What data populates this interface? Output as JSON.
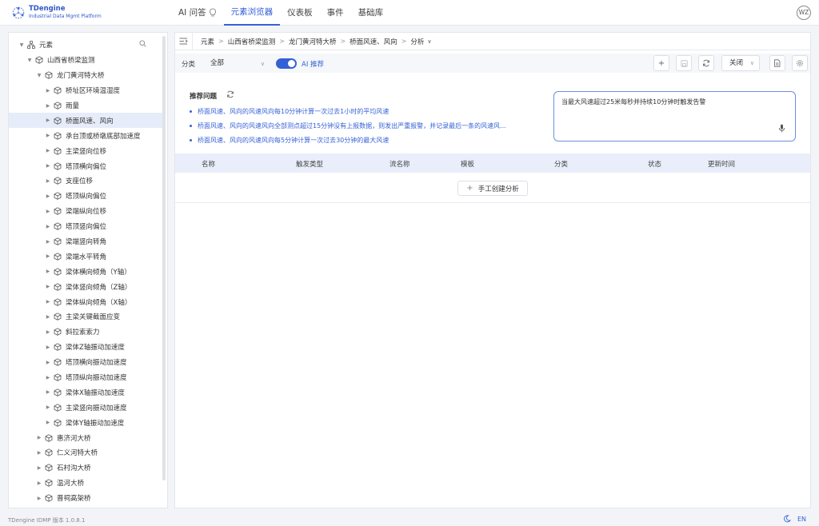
{
  "app": {
    "logo_title": "TDengine",
    "logo_subtitle": "Industrial Data Mgmt Platform",
    "brand_color": "#3561d6"
  },
  "nav": {
    "items": [
      {
        "label": "AI 问答"
      },
      {
        "label": "元素浏览器",
        "active": true
      },
      {
        "label": "仪表板"
      },
      {
        "label": "事件"
      },
      {
        "label": "基础库"
      }
    ],
    "user_initials": "WZ"
  },
  "sidebar": {
    "tree": [
      {
        "label": "元素",
        "level": 0,
        "icon": "hierarchy-icon",
        "expanded": true
      },
      {
        "label": "山西省桥梁监测",
        "level": 1,
        "icon": "cube-icon",
        "expanded": true
      },
      {
        "label": "龙门黄河特大桥",
        "level": 2,
        "icon": "cube-icon",
        "expanded": true
      },
      {
        "label": "桥址区环境温湿度",
        "level": 3,
        "icon": "cube-icon"
      },
      {
        "label": "雨量",
        "level": 3,
        "icon": "cube-icon"
      },
      {
        "label": "桥面风速、风向",
        "level": 3,
        "icon": "cube-icon",
        "selected": true
      },
      {
        "label": "承台顶或桥墩底部加速度",
        "level": 3,
        "icon": "cube-icon"
      },
      {
        "label": "主梁竖向位移",
        "level": 3,
        "icon": "cube-icon"
      },
      {
        "label": "塔顶横向偏位",
        "level": 3,
        "icon": "cube-icon"
      },
      {
        "label": "支座位移",
        "level": 3,
        "icon": "cube-icon"
      },
      {
        "label": "塔顶纵向偏位",
        "level": 3,
        "icon": "cube-icon"
      },
      {
        "label": "梁端纵向位移",
        "level": 3,
        "icon": "cube-icon"
      },
      {
        "label": "塔顶竖向偏位",
        "level": 3,
        "icon": "cube-icon"
      },
      {
        "label": "梁端竖向转角",
        "level": 3,
        "icon": "cube-icon"
      },
      {
        "label": "梁端水平转角",
        "level": 3,
        "icon": "cube-icon"
      },
      {
        "label": "梁体横向倾角（Y轴）",
        "level": 3,
        "icon": "cube-icon"
      },
      {
        "label": "梁体竖向倾角（Z轴）",
        "level": 3,
        "icon": "cube-icon"
      },
      {
        "label": "梁体纵向倾角（X轴）",
        "level": 3,
        "icon": "cube-icon"
      },
      {
        "label": "主梁关键截面应变",
        "level": 3,
        "icon": "cube-icon"
      },
      {
        "label": "斜拉索索力",
        "level": 3,
        "icon": "cube-icon"
      },
      {
        "label": "梁体Z轴振动加速度",
        "level": 3,
        "icon": "cube-icon"
      },
      {
        "label": "塔顶横向振动加速度",
        "level": 3,
        "icon": "cube-icon"
      },
      {
        "label": "塔顶纵向振动加速度",
        "level": 3,
        "icon": "cube-icon"
      },
      {
        "label": "梁体X轴振动加速度",
        "level": 3,
        "icon": "cube-icon"
      },
      {
        "label": "主梁竖向振动加速度",
        "level": 3,
        "icon": "cube-icon"
      },
      {
        "label": "梁体Y轴振动加速度",
        "level": 3,
        "icon": "cube-icon"
      },
      {
        "label": "惠济河大桥",
        "level": 2,
        "icon": "cube-icon"
      },
      {
        "label": "仁义河特大桥",
        "level": 2,
        "icon": "cube-icon"
      },
      {
        "label": "石村沟大桥",
        "level": 2,
        "icon": "cube-icon"
      },
      {
        "label": "温河大桥",
        "level": 2,
        "icon": "cube-icon"
      },
      {
        "label": "晋祠高架桥",
        "level": 2,
        "icon": "cube-icon"
      }
    ]
  },
  "breadcrumb": {
    "items": [
      "元素",
      "山西省桥梁监测",
      "龙门黄河特大桥",
      "桥面风速、风向",
      "分析"
    ]
  },
  "toolbar": {
    "category_label": "分类",
    "category_value": "全部",
    "ai_toggle_on": true,
    "ai_label": "AI 推荐",
    "close_label": "关闭"
  },
  "recommend": {
    "title": "推荐问题",
    "questions": [
      "桥面风速、风向的风速风向每10分钟计算一次过去1小时的平均风速",
      "桥面风速、风向的风速风向全部测点超过15分钟没有上报数据，则发出严重报警，并记录最后一条的风速风...",
      "桥面风速、风向的风速风向每5分钟计算一次过去30分钟的最大风速"
    ],
    "input_value": "当最大风速超过25米每秒并持续10分钟时触发告警"
  },
  "table": {
    "columns": [
      "名称",
      "触发类型",
      "流名称",
      "模板",
      "分类",
      "状态",
      "更新时间"
    ],
    "create_button": "手工创建分析"
  },
  "footer": {
    "version": "TDengine IDMP 版本 1.0.8.1",
    "lang": "EN"
  }
}
